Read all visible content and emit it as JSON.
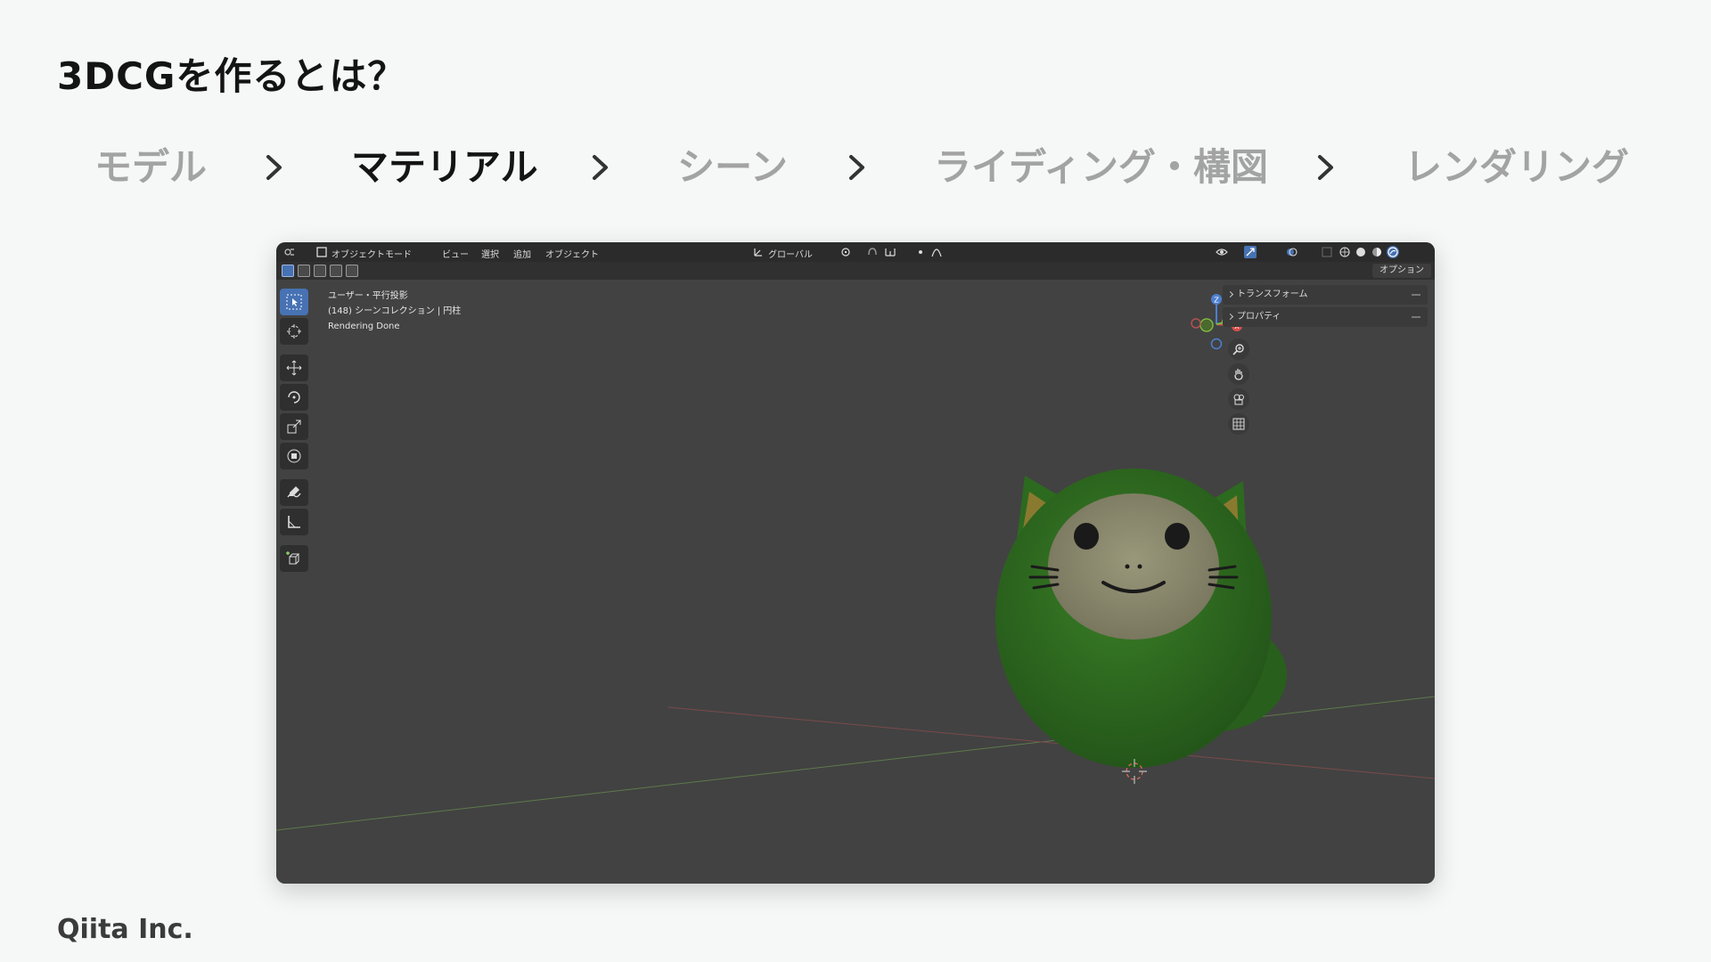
{
  "slide": {
    "title": "3DCGを作るとは？",
    "footer": "Qiita Inc."
  },
  "steps": [
    {
      "label": "モデル",
      "active": false
    },
    {
      "label": "マテリアル",
      "active": true
    },
    {
      "label": "シーン",
      "active": false
    },
    {
      "label": "ライディング・構図",
      "active": false
    },
    {
      "label": "レンダリング",
      "active": false
    }
  ],
  "blender": {
    "header": {
      "mode": "オブジェクトモード",
      "menus": [
        "ビュー",
        "選択",
        "追加",
        "オブジェクト"
      ],
      "orientation": "グローバル"
    },
    "options_button": "オプション",
    "overlay": {
      "view": "ユーザー・平行投影",
      "collection": "(148) シーンコレクション | 円柱",
      "status": "Rendering Done"
    },
    "npanel": [
      "トランスフォーム",
      "プロパティ"
    ],
    "gizmo_axes": [
      "Z",
      "Y",
      "X"
    ],
    "colors": {
      "accent": "#4772b3",
      "model_green": "#2e6a1e",
      "face": "#8c8a6e"
    }
  }
}
